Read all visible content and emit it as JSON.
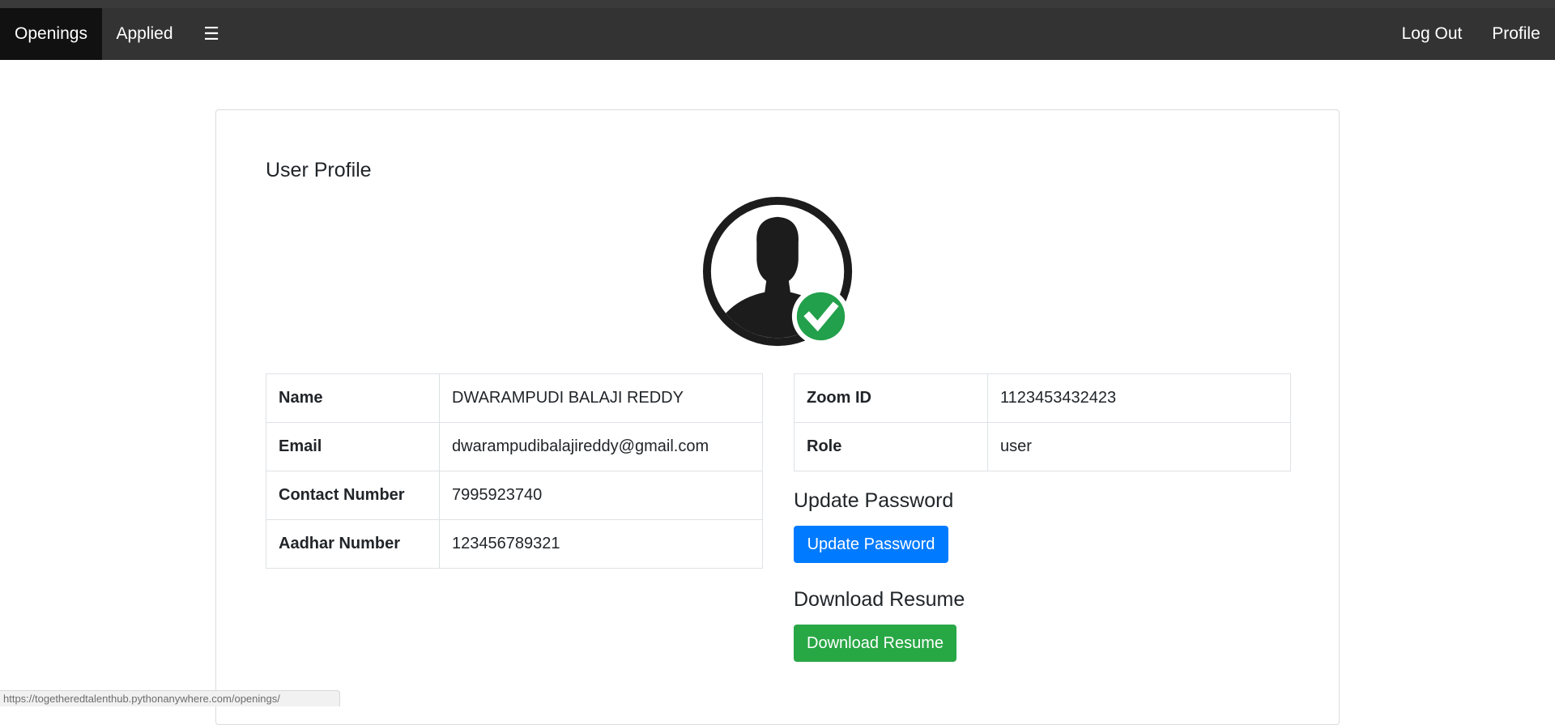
{
  "navbar": {
    "openings": "Openings",
    "applied": "Applied",
    "menu_icon": "☰",
    "logout": "Log Out",
    "profile": "Profile"
  },
  "profile": {
    "title": "User Profile",
    "avatar_icon": "verified-user-avatar-icon",
    "left_rows": [
      {
        "label": "Name",
        "value": "DWARAMPUDI BALAJI REDDY"
      },
      {
        "label": "Email",
        "value": "dwarampudibalajireddy@gmail.com"
      },
      {
        "label": "Contact Number",
        "value": "7995923740"
      },
      {
        "label": "Aadhar Number",
        "value": "123456789321"
      }
    ],
    "right_rows": [
      {
        "label": "Zoom ID",
        "value": "1123453432423"
      },
      {
        "label": "Role",
        "value": "user"
      }
    ],
    "update_heading": "Update Password",
    "update_button": "Update Password",
    "download_heading": "Download Resume",
    "download_button": "Download Resume"
  },
  "status_url": "https://togetheredtalenthub.pythonanywhere.com/openings/",
  "colors": {
    "navbar": "#333333",
    "nav_active": "#111111",
    "primary": "#007bff",
    "success": "#28a745"
  }
}
